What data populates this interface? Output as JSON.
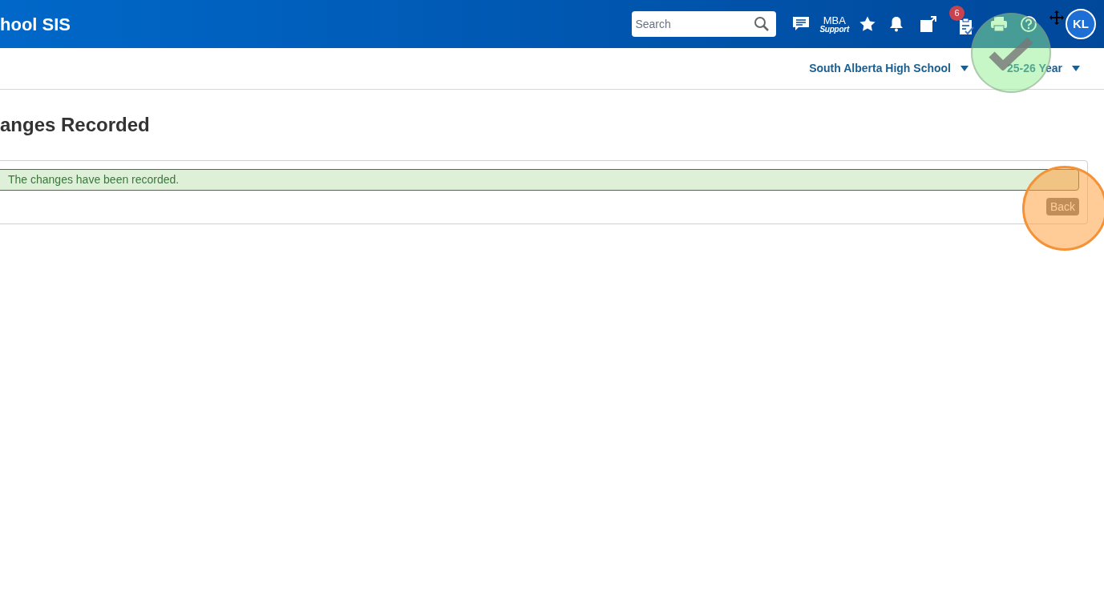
{
  "header": {
    "app_title": "hool SIS",
    "search": {
      "placeholder": "Search"
    },
    "support": {
      "line_1": "MBA",
      "line_2": "Support"
    },
    "notification_count": "6",
    "avatar": "KL"
  },
  "context_bar": {
    "school": "South Alberta High School",
    "year": "25-26 Year"
  },
  "page_title": "anges Recorded",
  "alert": {
    "message": "The changes have been recorded."
  },
  "buttons": [
    "Back"
  ]
}
